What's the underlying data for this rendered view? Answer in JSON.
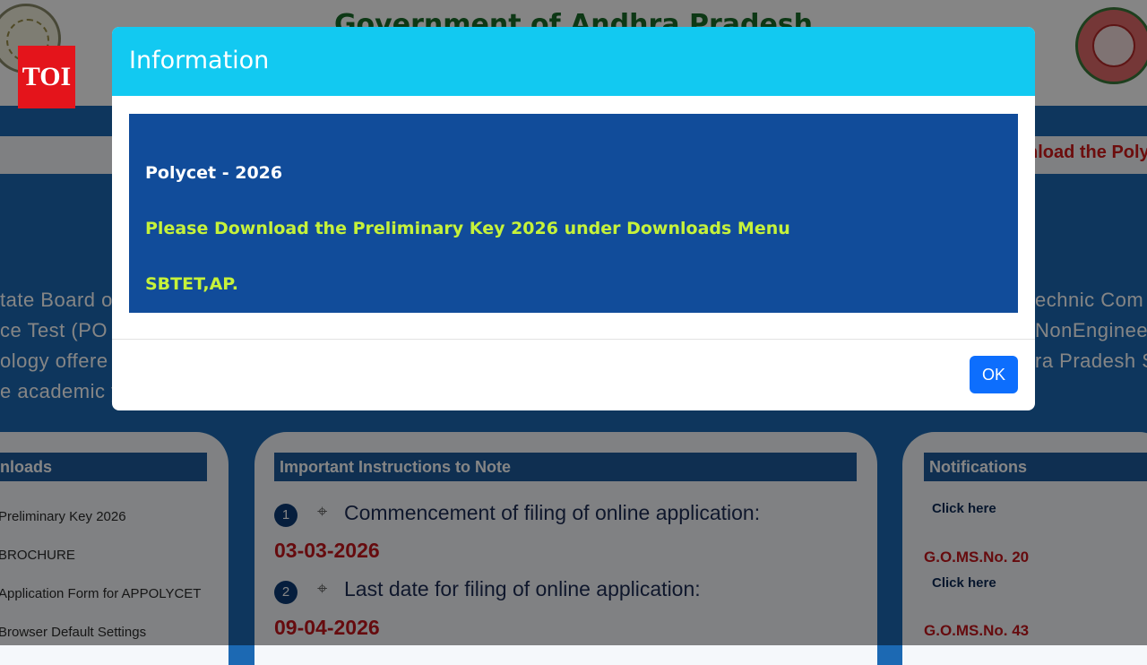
{
  "header": {
    "title": "Government of Andhra Pradesh",
    "left_logo_icon": "ap-government-emblem-icon",
    "right_logo_icon": "sbtet-seal-icon"
  },
  "watermark": {
    "label": "TOI",
    "color": "#e4141b"
  },
  "marquee": {
    "text": "nload the Poly"
  },
  "intro": {
    "line1_left": "tate  Board  o",
    "line1_right": "echnic  Com",
    "line2_left": "ce  Test  (PO",
    "line2_right": "NonEngineeri",
    "line3_left": "ology offere",
    "line3_right": "ra Pradesh S",
    "line4_left": "e academic y"
  },
  "downloads": {
    "heading": "nloads",
    "items": [
      {
        "label": "Preliminary Key 2026"
      },
      {
        "label": "BROCHURE"
      },
      {
        "label": "Application Form for APPOLYCET"
      },
      {
        "label": "Browser Default Settings"
      }
    ]
  },
  "instructions": {
    "heading": "Important Instructions to Note",
    "items": [
      {
        "num": "1",
        "text": "Commencement of filing of online application:",
        "date": "03-03-2026",
        "icon": "crosshair-icon"
      },
      {
        "num": "2",
        "text": "Last date for filing of online application:",
        "date": "09-04-2026",
        "icon": "crosshair-icon"
      }
    ]
  },
  "notifications": {
    "heading": "Notifications",
    "items": [
      {
        "link": "Click here",
        "title": "G.O.MS.No. 20"
      },
      {
        "link": "Click here",
        "title": "G.O.MS.No. 43"
      }
    ]
  },
  "modal": {
    "title": "Information",
    "line1": "Polycet - 2026",
    "line2": "Please Download the Preliminary Key 2026 under Downloads Menu",
    "line3": "SBTET,AP.",
    "ok_label": "OK"
  },
  "colors": {
    "page_blue": "#1c69b3",
    "modal_header": "#12c9f1",
    "message_box": "#114c9a",
    "message_highlight": "#c6f23a",
    "ok_button": "#0d6efd",
    "date_red": "#c4161c"
  }
}
